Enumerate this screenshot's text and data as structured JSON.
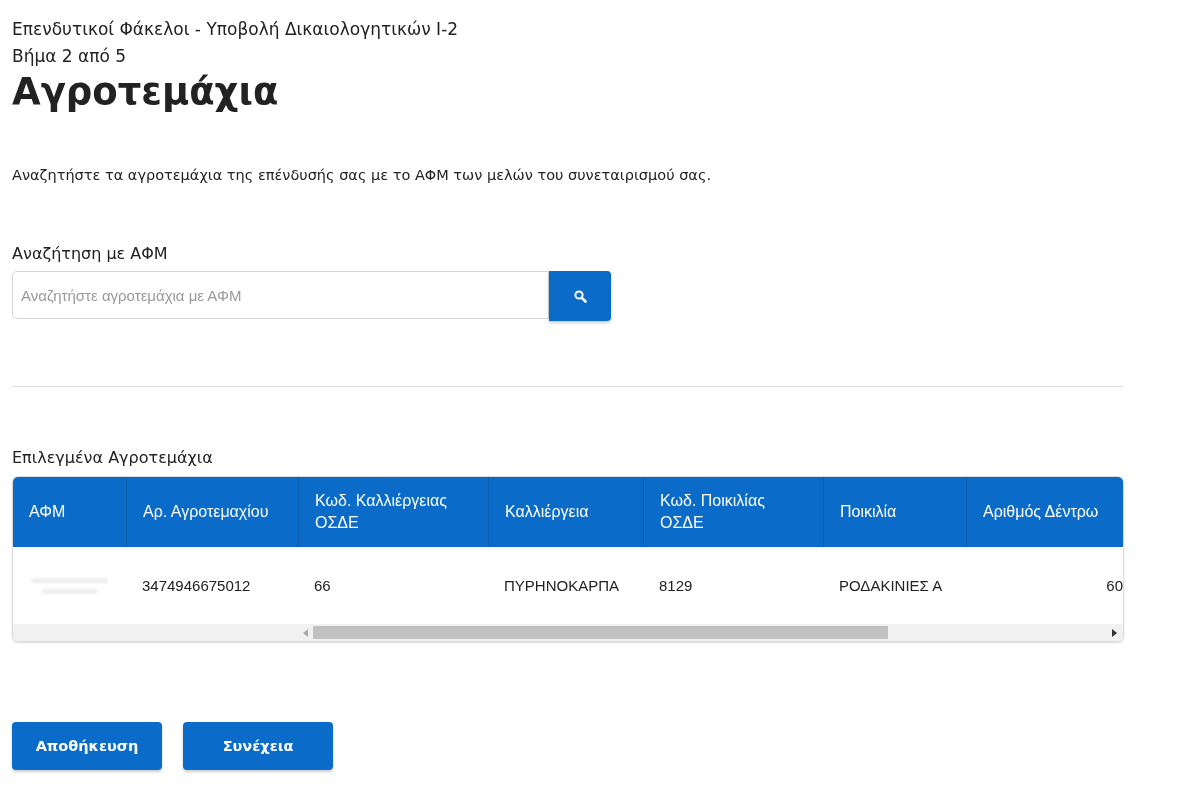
{
  "breadcrumb": "Επενδυτικοί Φάκελοι - Υποβολή Δικαιολογητικών Ι-2",
  "step": "Βήμα 2 από 5",
  "title": "Αγροτεμάχια",
  "intro": "Αναζητήστε τα αγροτεμάχια της επένδυσής σας με το ΑΦΜ των μελών του συνεταιρισμού σας.",
  "search": {
    "label": "Αναζήτηση με ΑΦΜ",
    "placeholder": "Αναζητήστε αγροτεμάχια με ΑΦΜ"
  },
  "table": {
    "caption": "Επιλεγμένα Αγροτεμάχια",
    "columns": [
      "ΑΦΜ",
      "Αρ. Αγροτεμαχίου",
      "Κωδ. Καλλιέργειας ΟΣΔΕ",
      "Καλλιέργεια",
      "Κωδ. Ποικιλίας ΟΣΔΕ",
      "Ποικιλία",
      "Αριθμός Δέντρω"
    ],
    "rows": [
      {
        "cells": [
          {
            "kind": "redacted"
          },
          {
            "kind": "text",
            "text": "3474946675012"
          },
          {
            "kind": "text",
            "text": "66"
          },
          {
            "kind": "text",
            "text": "ΠΥΡΗΝΟΚΑΡΠΑ"
          },
          {
            "kind": "text",
            "text": "8129"
          },
          {
            "kind": "text",
            "text": "ΡΟΔΑΚΙΝΙΕΣ Α"
          },
          {
            "kind": "number",
            "text": "60"
          }
        ]
      }
    ]
  },
  "buttons": [
    "Αποθήκευση",
    "Συνέχεια"
  ]
}
